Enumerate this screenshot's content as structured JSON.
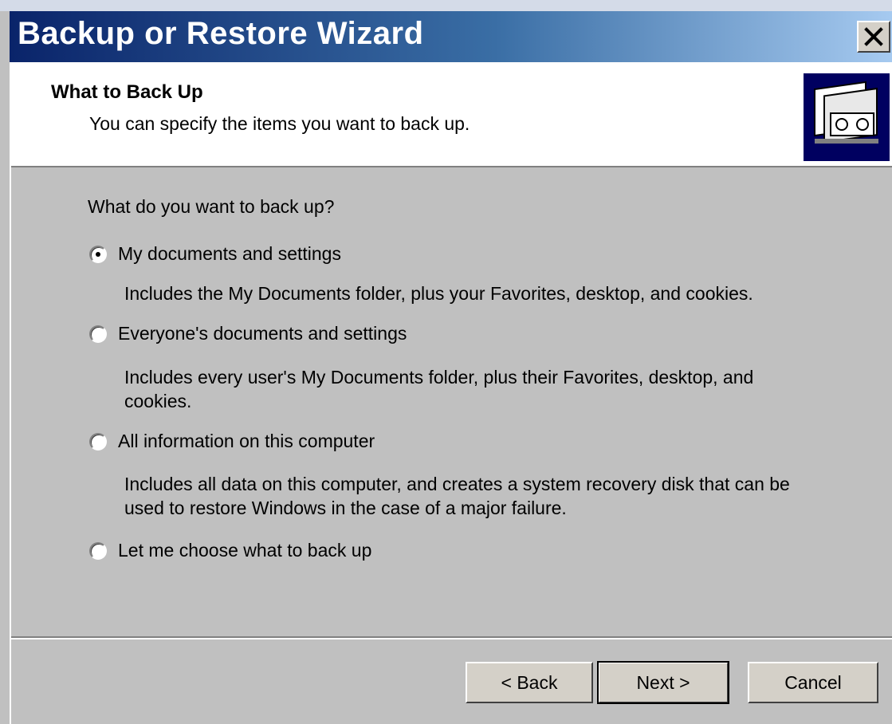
{
  "window": {
    "title": "Backup or Restore Wizard"
  },
  "header": {
    "title": "What to Back Up",
    "subtitle": "You can specify the items you want to back up."
  },
  "content": {
    "question": "What do you want to back up?",
    "options": [
      {
        "label": "My documents and settings",
        "description": "Includes the My Documents folder, plus your Favorites, desktop, and cookies.",
        "checked": true
      },
      {
        "label": "Everyone's documents and settings",
        "description": "Includes every user's My Documents folder, plus their Favorites, desktop, and cookies.",
        "checked": false
      },
      {
        "label": "All information on this computer",
        "description": "Includes all data on this computer, and creates a system recovery disk that can be used to restore Windows in the case of a major failure.",
        "checked": false
      },
      {
        "label": "Let me choose what to back up",
        "description": "",
        "checked": false
      }
    ]
  },
  "buttons": {
    "back": "< Back",
    "next": "Next >",
    "cancel": "Cancel"
  },
  "icons": {
    "close": "close-icon",
    "wizard": "backup-wizard-icon",
    "radio_selected": "radio-selected-icon"
  },
  "colors": {
    "titlebar_start": "#0a246a",
    "titlebar_end": "#a6caf0",
    "dialog_background": "#c0c0c0"
  }
}
